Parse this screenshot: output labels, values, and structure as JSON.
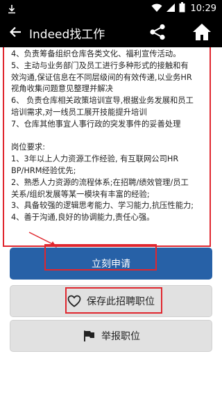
{
  "status_bar": {
    "time": "10:29",
    "icons": [
      "download-icon",
      "wifi-icon",
      "signal-icon",
      "battery-icon"
    ]
  },
  "app_bar": {
    "title": "Indeed找工作",
    "icons": [
      "back-arrow-icon",
      "share-icon",
      "home-icon"
    ]
  },
  "job_description": {
    "lines": [
      "4、负责筹备组织仓库各类文化、福利宣传活动。",
      "5、主动与业务部门及员工进行多种形式的接触和有",
      "效沟通,保证信息在不同层级间的有效传递,以业务HR",
      "视角收集问题意见整理并解决",
      "6、 负责仓库相关政策培训宣导,根据业务发展和员工",
      "培训需求,对一线员工展开技能提升培训",
      "7、仓库其他事宜人事行政的突发事件的妥善处理",
      "",
      "岗位要求:",
      "1、3年以上人力资源工作经验, 有互联网公司HR",
      "BP/HRM经验优先;",
      "2、熟悉人力资源的流程体系;在招聘/绩效管理/员工",
      "关系/组织发展等某一模块有丰富的经验;",
      "3、具备较强的逻辑思考能力、学习能力,抗压性能力;",
      "4、善于沟通,良好的协调能力,责任心强。"
    ]
  },
  "actions": {
    "apply_label": "立刻申请",
    "save_label": "保存此招聘职位",
    "report_label": "举报职位"
  },
  "colors": {
    "bar_bg": "#000000",
    "apply_button": "#2761a7",
    "secondary_button": "#e1e1e1",
    "annotation_red": "#e0262e"
  }
}
